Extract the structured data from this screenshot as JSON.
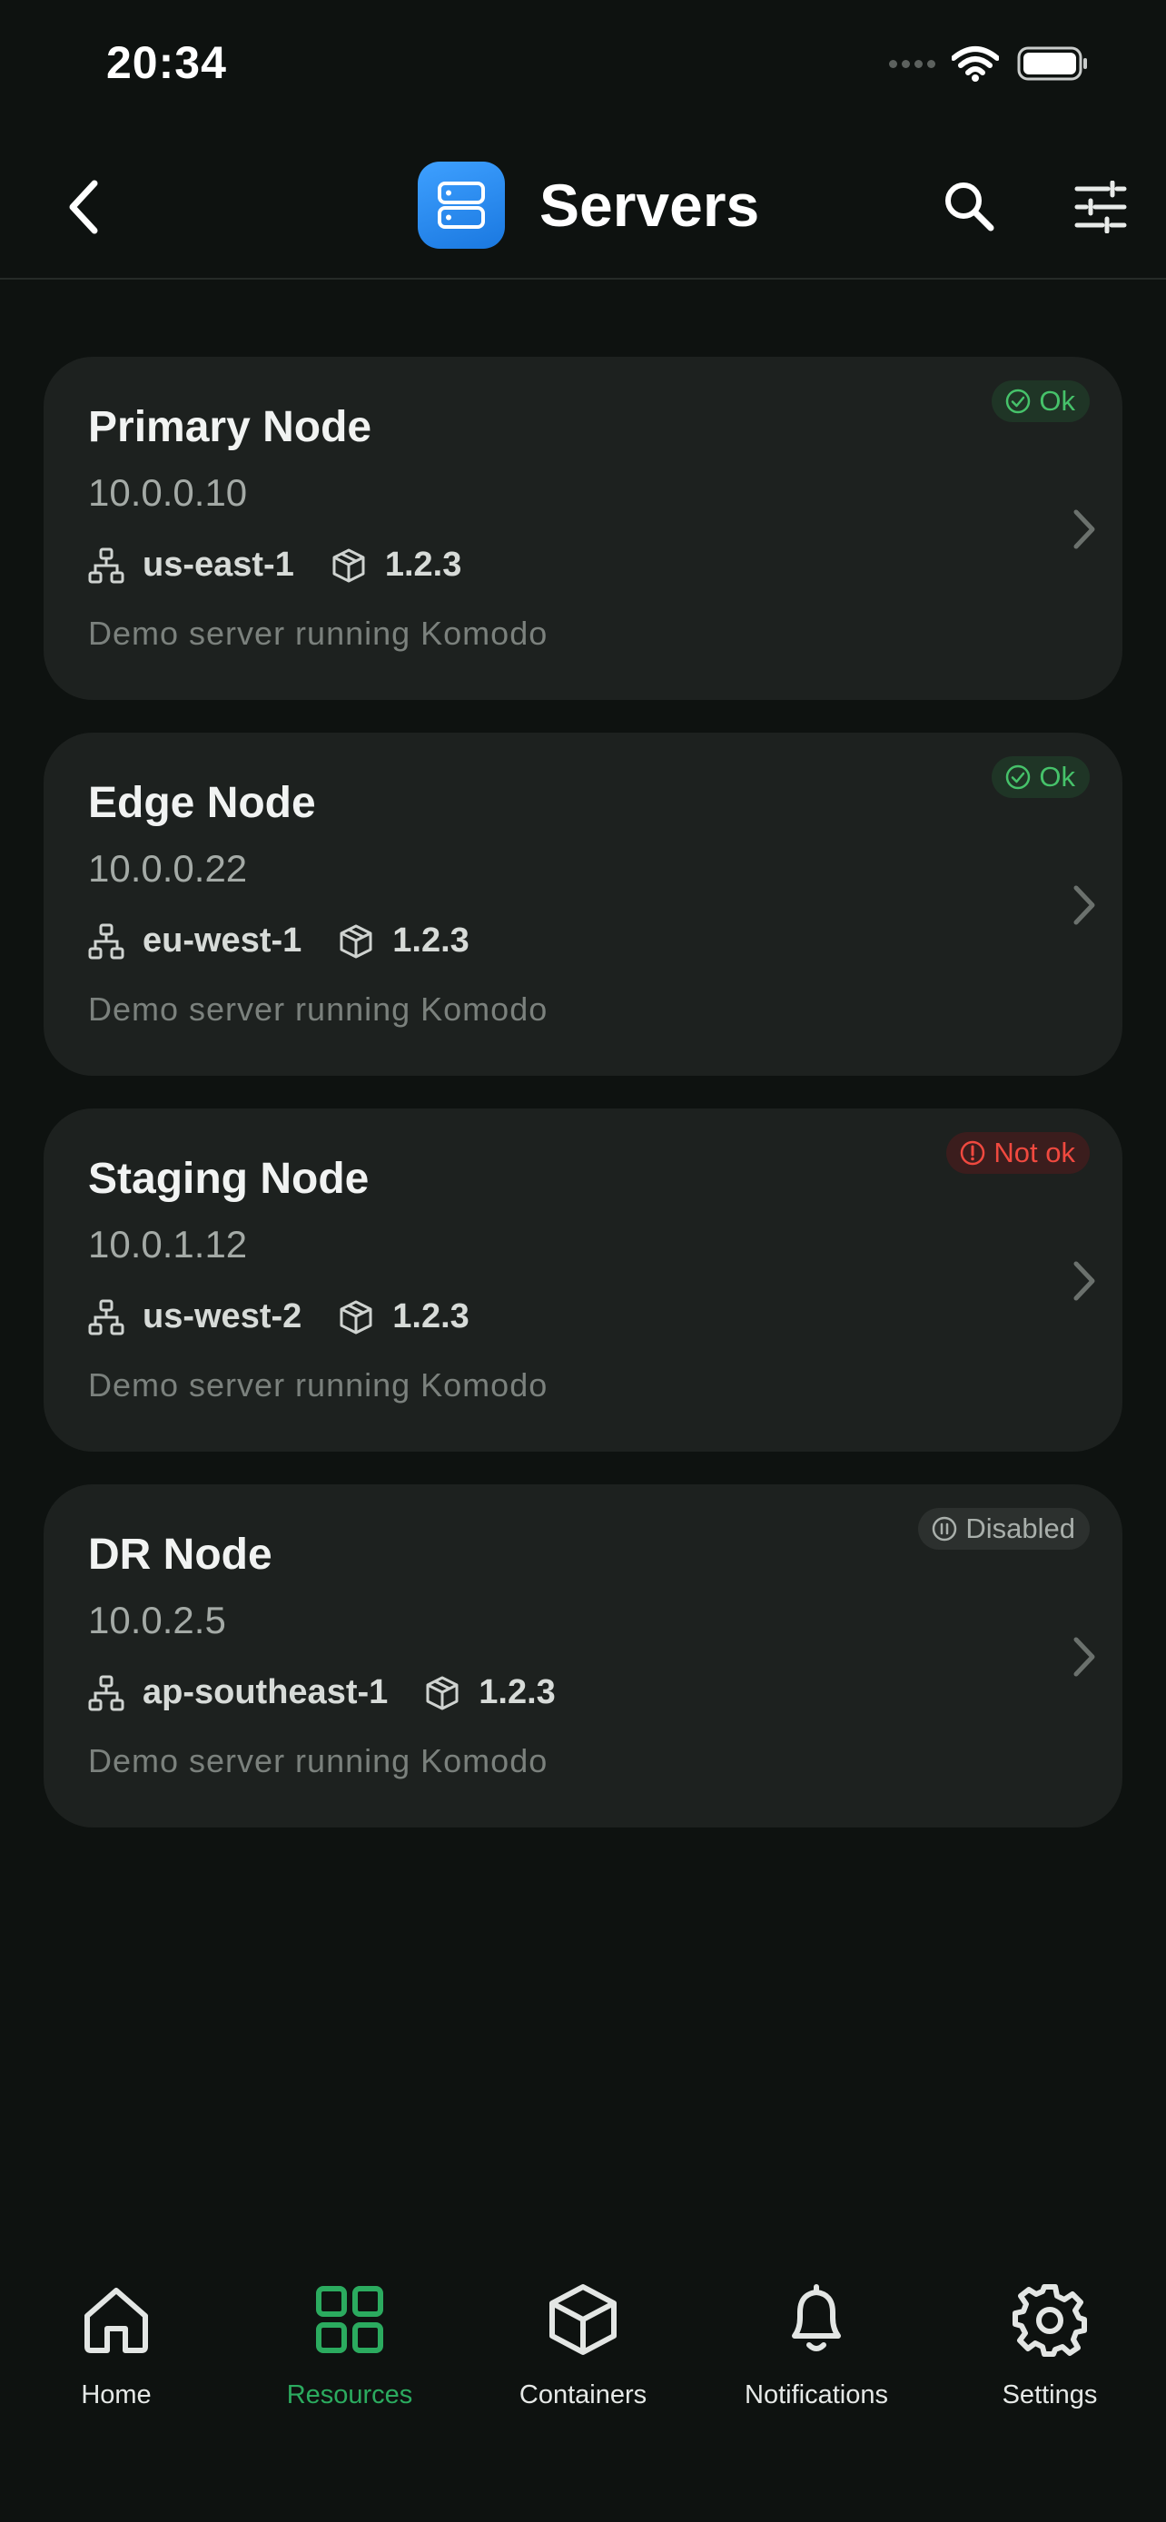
{
  "status_bar": {
    "time": "20:34"
  },
  "header": {
    "title": "Servers"
  },
  "servers": [
    {
      "name": "Primary Node",
      "ip": "10.0.0.10",
      "region": "us-east-1",
      "version": "1.2.3",
      "description": "Demo server running Komodo",
      "status": "Ok"
    },
    {
      "name": "Edge Node",
      "ip": "10.0.0.22",
      "region": "eu-west-1",
      "version": "1.2.3",
      "description": "Demo server running Komodo",
      "status": "Ok"
    },
    {
      "name": "Staging Node",
      "ip": "10.0.1.12",
      "region": "us-west-2",
      "version": "1.2.3",
      "description": "Demo server running Komodo",
      "status": "Not ok"
    },
    {
      "name": "DR Node",
      "ip": "10.0.2.5",
      "region": "ap-southeast-1",
      "version": "1.2.3",
      "description": "Demo server running Komodo",
      "status": "Disabled"
    }
  ],
  "tabs": [
    {
      "label": "Home",
      "icon": "home-icon"
    },
    {
      "label": "Resources",
      "icon": "grid-icon",
      "active": true
    },
    {
      "label": "Containers",
      "icon": "box-icon"
    },
    {
      "label": "Notifications",
      "icon": "bell-icon"
    },
    {
      "label": "Settings",
      "icon": "gear-icon"
    }
  ],
  "colors": {
    "background": "#0e1210",
    "card": "#1d211f",
    "accent_green": "#2bab5f",
    "ok": "#46c26a",
    "not_ok": "#f0493f",
    "app_icon_blue": "#2b8cf0"
  }
}
